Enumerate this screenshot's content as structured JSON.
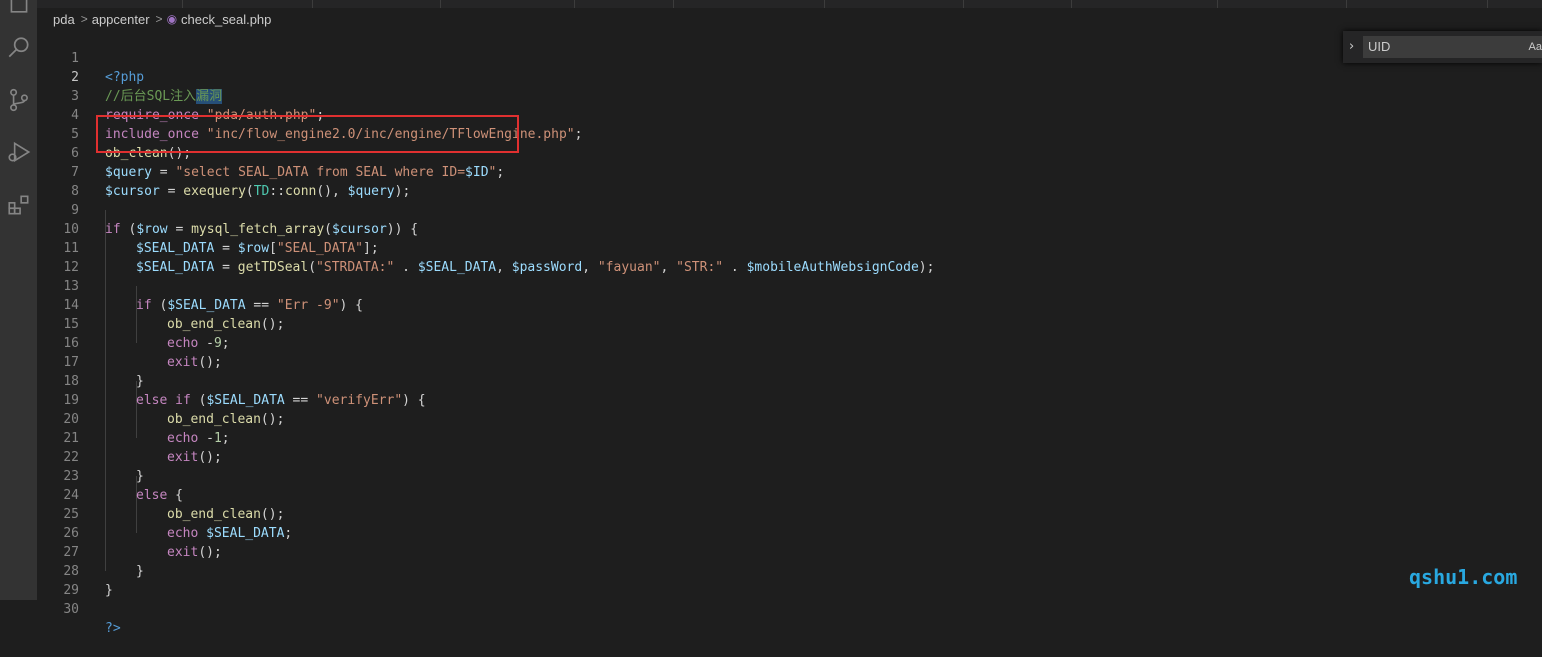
{
  "breadcrumb": {
    "parts": [
      "pda",
      "appcenter"
    ],
    "file": "check_seal.php"
  },
  "find": {
    "value": "UID",
    "option_label": "Aa"
  },
  "watermark": "qshu1.com",
  "colors": {
    "highlight_box": "#e03030",
    "watermark": "#29a8e0"
  },
  "lines": [
    {
      "n": "1"
    },
    {
      "n": "2"
    },
    {
      "n": "3"
    },
    {
      "n": "4"
    },
    {
      "n": "5"
    },
    {
      "n": "6"
    },
    {
      "n": "7"
    },
    {
      "n": "8"
    },
    {
      "n": "9"
    },
    {
      "n": "10"
    },
    {
      "n": "11"
    },
    {
      "n": "12"
    },
    {
      "n": "13"
    },
    {
      "n": "14"
    },
    {
      "n": "15"
    },
    {
      "n": "16"
    },
    {
      "n": "17"
    },
    {
      "n": "18"
    },
    {
      "n": "19"
    },
    {
      "n": "20"
    },
    {
      "n": "21"
    },
    {
      "n": "22"
    },
    {
      "n": "23"
    },
    {
      "n": "24"
    },
    {
      "n": "25"
    },
    {
      "n": "26"
    },
    {
      "n": "27"
    },
    {
      "n": "28"
    },
    {
      "n": "29"
    },
    {
      "n": "30"
    }
  ],
  "code": {
    "l1": {
      "open": "<?php"
    },
    "l2": {
      "comment": "//后台SQL注入",
      "selected": "漏洞"
    },
    "l3": {
      "kw": "require_once",
      "str": "\"pda/auth.php\"",
      "end": ";"
    },
    "l4": {
      "kw": "include_once",
      "str": "\"inc/flow_engine2.0/inc/engine/TFlowEngine.php\"",
      "end": ";"
    },
    "l5": {
      "fn": "ob_clean",
      "end": "();"
    },
    "l6": {
      "var": "$query",
      "op": " = ",
      "str": "\"select SEAL_DATA from SEAL where ID=",
      "var2": "$ID",
      "str2": "\"",
      "end": ";"
    },
    "l7": {
      "var": "$cursor",
      "op": " = ",
      "fn": "exequery",
      "p1": "(",
      "cls": "TD",
      "p2": "::",
      "fn2": "conn",
      "p3": "(), ",
      "var2": "$query",
      "end": ");"
    },
    "l9": {
      "kw": "if",
      "p1": " (",
      "var": "$row",
      "op": " = ",
      "fn": "mysql_fetch_array",
      "p2": "(",
      "var2": "$cursor",
      "end": ")) {"
    },
    "l10": {
      "var": "$SEAL_DATA",
      "op": " = ",
      "var2": "$row",
      "p1": "[",
      "str": "\"SEAL_DATA\"",
      "end": "];"
    },
    "l11": {
      "var": "$SEAL_DATA",
      "op": " = ",
      "fn": "getTDSeal",
      "p1": "(",
      "str": "\"STRDATA:\"",
      "p2": " . ",
      "var2": "$SEAL_DATA",
      "p3": ", ",
      "var3": "$passWord",
      "p4": ", ",
      "str2": "\"fayuan\"",
      "p5": ", ",
      "str3": "\"STR:\"",
      "p6": " . ",
      "var4": "$mobileAuthWebsignCode",
      "end": ");"
    },
    "l13": {
      "kw": "if",
      "p1": " (",
      "var": "$SEAL_DATA",
      "op": " == ",
      "str": "\"Err -9\"",
      "end": ") {"
    },
    "l14": {
      "fn": "ob_end_clean",
      "end": "();"
    },
    "l15": {
      "kw": "echo",
      "op": " -",
      "num": "9",
      "end": ";"
    },
    "l16": {
      "kw": "exit",
      "end": "();"
    },
    "l17": {
      "end": "}"
    },
    "l18": {
      "kw": "else if",
      "p1": " (",
      "var": "$SEAL_DATA",
      "op": " == ",
      "str": "\"verifyErr\"",
      "end": ") {"
    },
    "l19": {
      "fn": "ob_end_clean",
      "end": "();"
    },
    "l20": {
      "kw": "echo",
      "op": " -",
      "num": "1",
      "end": ";"
    },
    "l21": {
      "kw": "exit",
      "end": "();"
    },
    "l22": {
      "end": "}"
    },
    "l23": {
      "kw": "else",
      "end": " {"
    },
    "l24": {
      "fn": "ob_end_clean",
      "end": "();"
    },
    "l25": {
      "kw": "echo",
      "var": " $SEAL_DATA",
      "end": ";"
    },
    "l26": {
      "kw": "exit",
      "end": "();"
    },
    "l27": {
      "end": "}"
    },
    "l28": {
      "end": "}"
    },
    "l30": {
      "close": "?>"
    }
  }
}
